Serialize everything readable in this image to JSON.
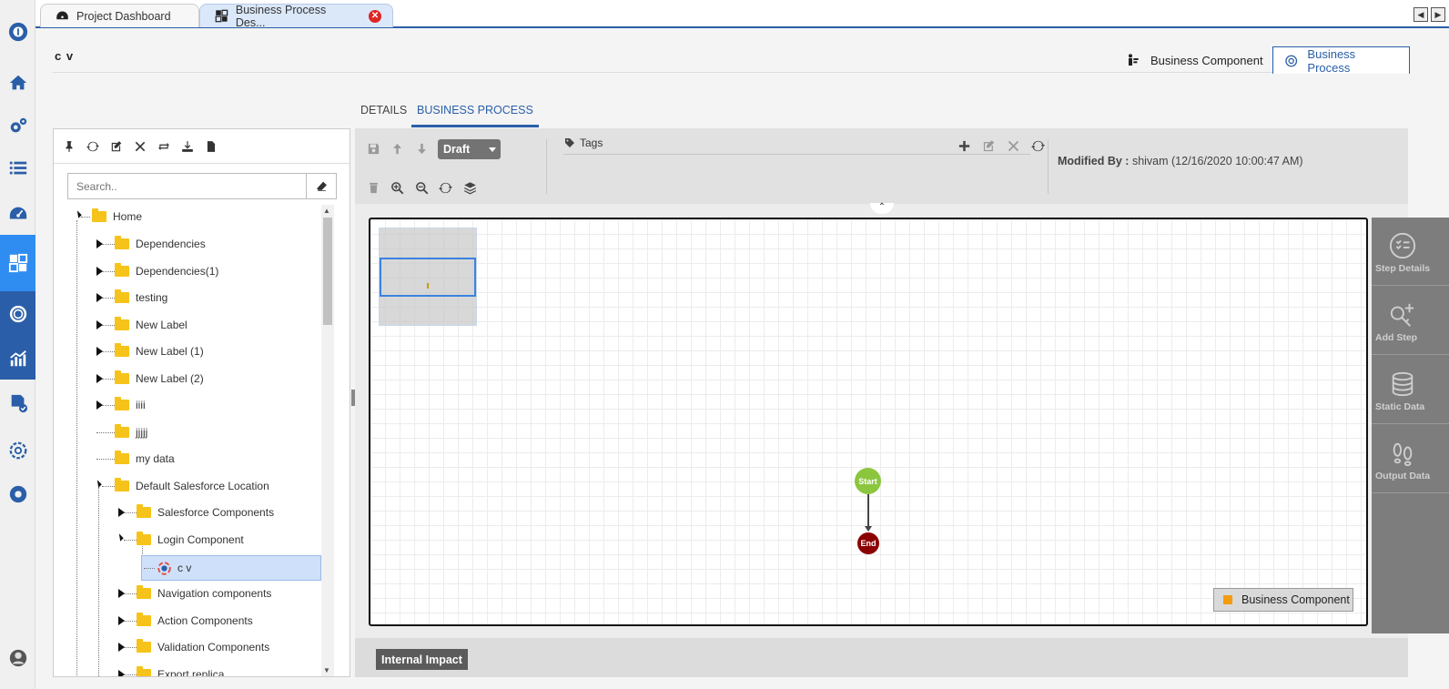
{
  "tabs": [
    {
      "label": "Project Dashboard"
    },
    {
      "label": "Business Process Des..."
    }
  ],
  "page": {
    "title": "c v"
  },
  "modes": {
    "component_label": "Business Component",
    "process_label": "Business Process"
  },
  "subtabs": [
    {
      "label": "DETAILS"
    },
    {
      "label": "BUSINESS PROCESS"
    }
  ],
  "search": {
    "placeholder": "Search.."
  },
  "tree": {
    "items": [
      {
        "label": "Home"
      },
      {
        "label": "Dependencies"
      },
      {
        "label": "Dependencies(1)"
      },
      {
        "label": "testing"
      },
      {
        "label": "New Label"
      },
      {
        "label": "New Label (1)"
      },
      {
        "label": "New Label (2)"
      },
      {
        "label": "iiii"
      },
      {
        "label": "jjjjj"
      },
      {
        "label": "my data"
      },
      {
        "label": "Default Salesforce Location"
      },
      {
        "label": "Salesforce Components"
      },
      {
        "label": "Login Component"
      },
      {
        "label": "c v"
      },
      {
        "label": "Navigation components"
      },
      {
        "label": "Action Components"
      },
      {
        "label": "Validation Components"
      },
      {
        "label": "Export replica"
      }
    ]
  },
  "toolbar": {
    "status_select": "Draft",
    "tags_label": "Tags",
    "modified_label": "Modified By :",
    "modified_value": "shivam (12/16/2020 10:00:47 AM)"
  },
  "canvas": {
    "start_label": "Start",
    "end_label": "End",
    "legend_label": "Business Component",
    "legend_color": "#f39c12"
  },
  "bottom": {
    "impact_label": "Internal Impact"
  },
  "side_panel": [
    {
      "label": "Step Details"
    },
    {
      "label": "Add Step"
    },
    {
      "label": "Static Data"
    },
    {
      "label": "Output Data"
    }
  ],
  "colors": {
    "accent": "#2a5ea8",
    "active_rail": "#2f8df2",
    "start_node": "#8cc63f",
    "end_node": "#8b0000"
  }
}
